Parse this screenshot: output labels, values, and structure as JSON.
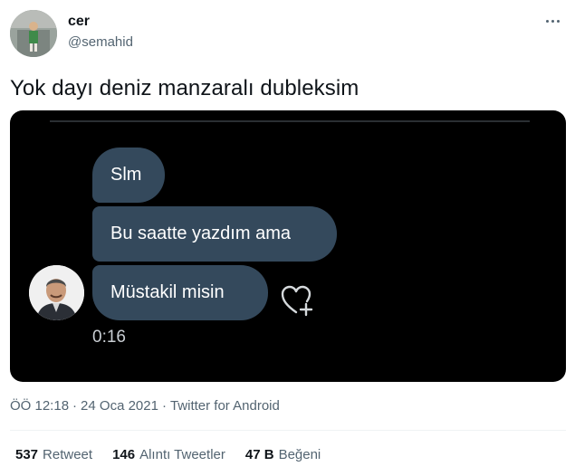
{
  "author": {
    "display_name": "cer",
    "handle": "@semahid"
  },
  "tweet": {
    "text": "Yok dayı deniz manzaralı dubleksim"
  },
  "media": {
    "messages": [
      "Slm",
      "Bu saatte yazdım ama",
      "Müstakil misin"
    ],
    "video_time": "0:16"
  },
  "meta": {
    "time": "ÖÖ 12:18",
    "separator": "·",
    "date": "24 Oca 2021",
    "source": "Twitter for Android"
  },
  "stats": {
    "retweets": {
      "count": "537",
      "label": "Retweet"
    },
    "quotes": {
      "count": "146",
      "label": "Alıntı Tweetler"
    },
    "likes": {
      "count": "47 B",
      "label": "Beğeni"
    }
  },
  "colors": {
    "bubble": "#34495c",
    "media_background": "#000000",
    "secondary_text": "#536471"
  }
}
